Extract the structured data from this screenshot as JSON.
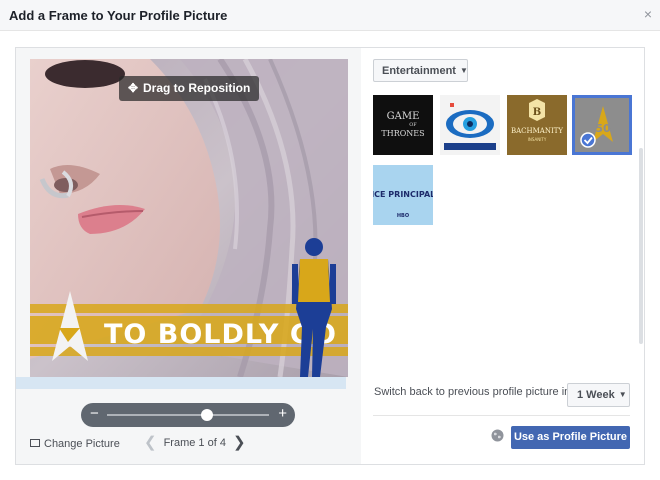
{
  "dialog": {
    "title": "Add a Frame to Your Profile Picture",
    "close_glyph": "×"
  },
  "preview": {
    "drag_label": "Drag to Reposition",
    "frame_text": "TO BOLDLY GO",
    "zoom_minus": "−",
    "zoom_plus": "+",
    "zoom_level": 0.62
  },
  "footer_left": {
    "change_picture_label": "Change Picture",
    "frame_counter": "Frame 1 of 4",
    "prev_glyph": "❮",
    "next_glyph": "❯"
  },
  "frames": {
    "category_label": "Entertainment",
    "items": [
      {
        "name": "Game of Thrones",
        "line1": "GAME",
        "line2": "OF",
        "line3": "THRONES",
        "selected": false
      },
      {
        "name": "Big Brother",
        "selected": false
      },
      {
        "name": "Bachmanity",
        "line1": "BACHMANITY",
        "line2": "INSANITY",
        "selected": false
      },
      {
        "name": "Star Trek 50",
        "selected": true
      },
      {
        "name": "Vice Principals",
        "line1": "VICE PRINCIPALS",
        "line2": "HBO",
        "selected": false
      }
    ]
  },
  "switch_back": {
    "label": "Switch back to previous profile picture in",
    "value": "1 Week"
  },
  "actions": {
    "use_label": "Use as Profile Picture"
  },
  "colors": {
    "primary": "#4267b2",
    "selected_border": "#4a76d4",
    "frame_banner": "#d8a71a",
    "uniform_blue": "#1c3e96"
  }
}
